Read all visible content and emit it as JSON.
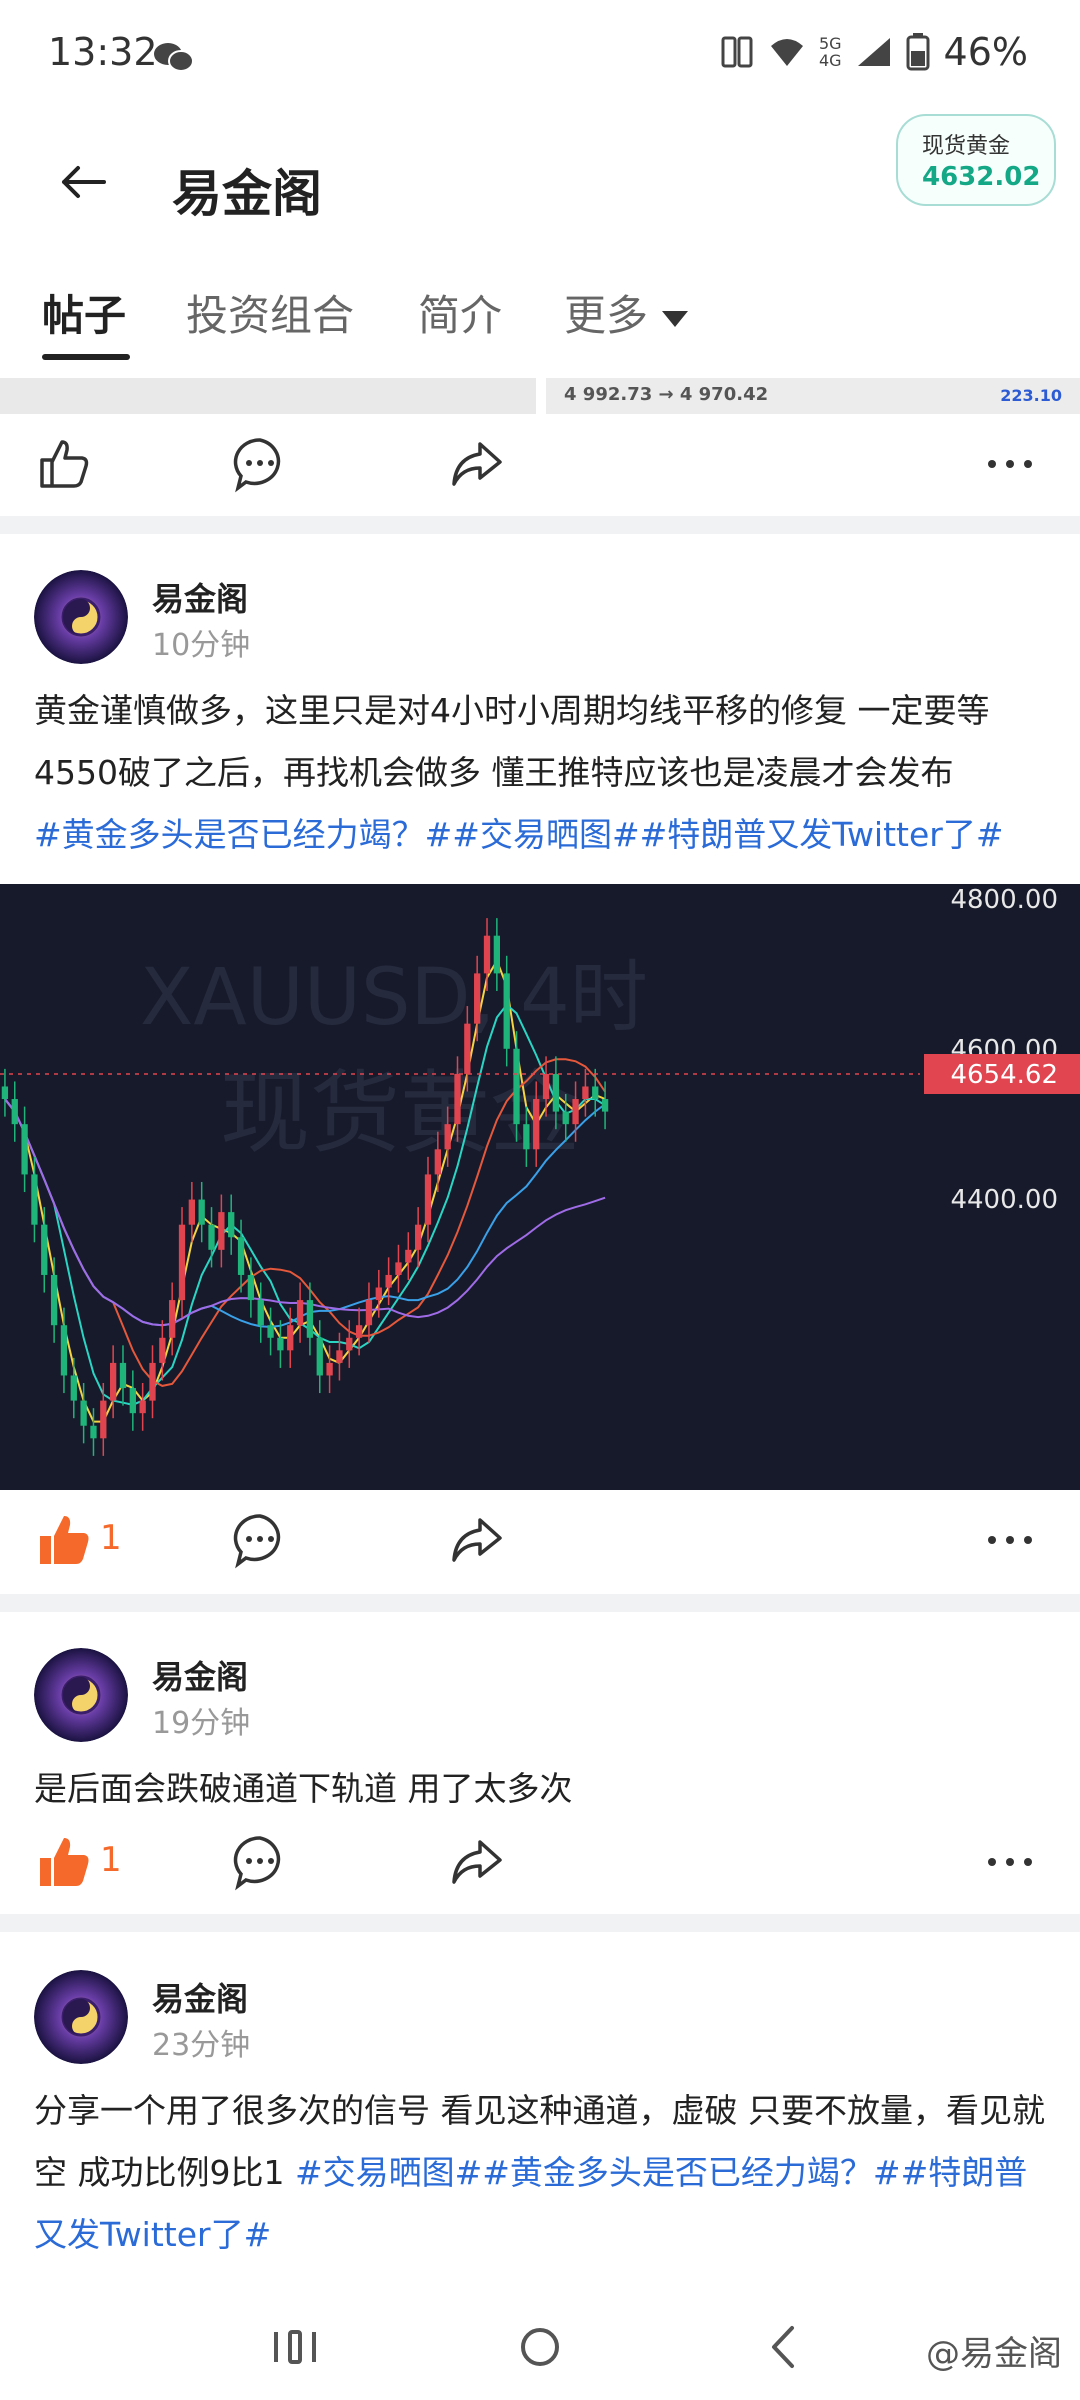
{
  "status": {
    "time": "13:32",
    "battery": "46%",
    "net1": "5G",
    "net2": "4G"
  },
  "header": {
    "title": "易金阁",
    "spot_label": "现货黄金",
    "spot_value": "4632.02"
  },
  "tabs": [
    {
      "label": "帖子",
      "active": true
    },
    {
      "label": "投资组合",
      "active": false
    },
    {
      "label": "简介",
      "active": false
    },
    {
      "label": "更多",
      "active": false
    }
  ],
  "prev_strip": {
    "price_change": "4 992.73 → 4 970.42",
    "right_num": "223.10"
  },
  "posts": [
    {
      "author": "易金阁",
      "time": "10分钟",
      "text": "黄金谨慎做多，这里只是对4小时小周期均线平移的修复 一定要等4550破了之后，再找机会做多 懂王推特应该也是凌晨才会发布",
      "tags": "#黄金多头是否已经力竭？##交易晒图##特朗普又发Twitter了#",
      "likes": "1"
    },
    {
      "author": "易金阁",
      "time": "19分钟",
      "text": "是后面会跌破通道下轨道 用了太多次",
      "likes": "1"
    },
    {
      "author": "易金阁",
      "time": "23分钟",
      "text": "分享一个用了很多次的信号 看见这种通道，虚破 只要不放量，看见就空 成功比例9比1 ",
      "tags": "#交易晒图##黄金多头是否已经力竭？##特朗普又发Twitter了#"
    }
  ],
  "chart_data": {
    "type": "candlestick",
    "watermark_line1": "XAUUSD, 4时",
    "watermark_line2": "现货黄金",
    "y_ticks": [
      "4800.00",
      "4600.00",
      "4400.00"
    ],
    "current_price": "4654.62",
    "ylim": [
      4360,
      4820
    ],
    "colors": {
      "up": "#e0454f",
      "down": "#1fb57a",
      "price_tag": "#e04550",
      "bg": "#161a2b"
    }
  },
  "navbar": {
    "watermark": "@易金阁"
  }
}
